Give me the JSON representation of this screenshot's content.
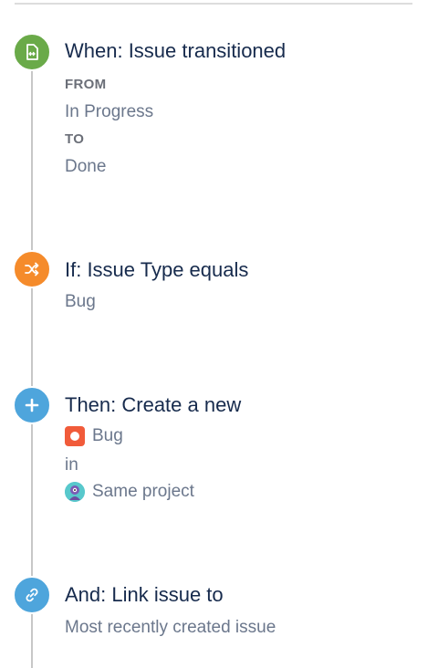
{
  "colors": {
    "trigger": "#6aaa49",
    "condition": "#f58b2b",
    "action": "#4ea5dc",
    "branch": "#4ea5dc"
  },
  "steps": [
    {
      "icon": "issue-transition-icon",
      "title": "When: Issue transitioned",
      "from_label": "FROM",
      "from_value": "In Progress",
      "to_label": "TO",
      "to_value": "Done"
    },
    {
      "icon": "shuffle-icon",
      "title": "If: Issue Type equals",
      "value": "Bug"
    },
    {
      "icon": "plus-icon",
      "title": "Then: Create a new",
      "issue_type": "Bug",
      "connector": "in",
      "project": "Same project"
    },
    {
      "icon": "link-icon",
      "title": "And: Link issue to",
      "value": "Most recently created issue"
    }
  ]
}
